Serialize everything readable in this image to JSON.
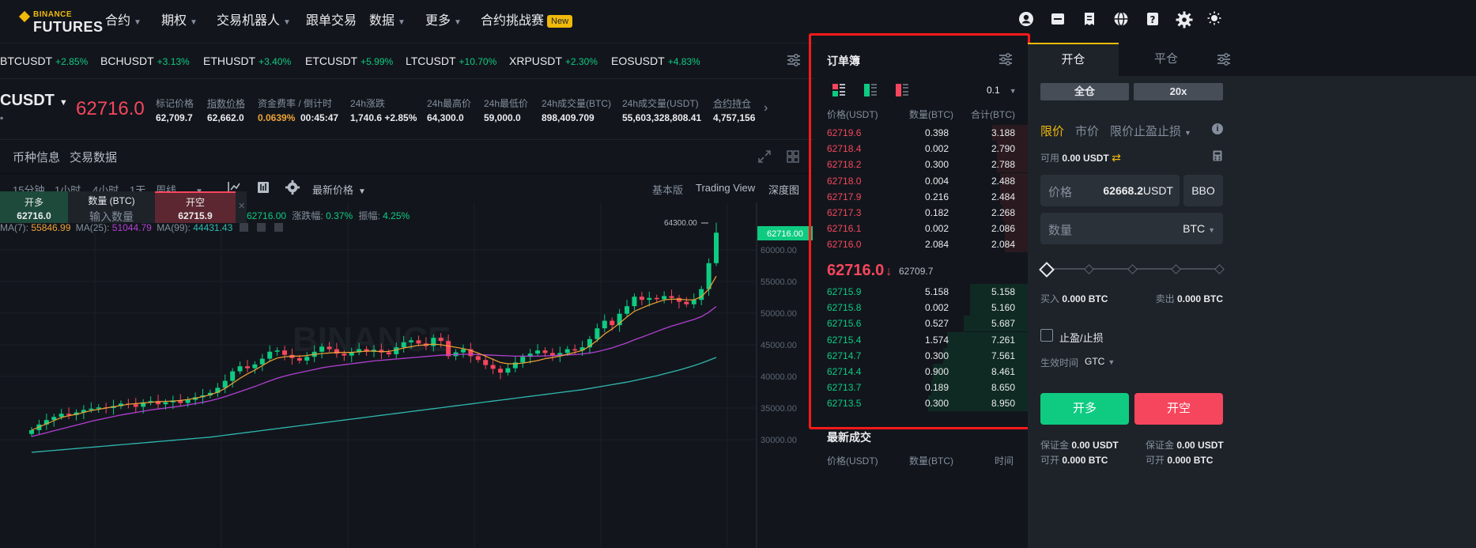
{
  "nav": {
    "logo_top": "BINANCE",
    "logo_bottom": "FUTURES",
    "items": [
      {
        "label": "合约",
        "dropdown": true
      },
      {
        "label": "期权",
        "dropdown": true
      },
      {
        "label": "交易机器人",
        "dropdown": true
      },
      {
        "label": "跟单交易",
        "dropdown": false
      },
      {
        "label": "数据",
        "dropdown": true
      },
      {
        "label": "更多",
        "dropdown": true
      },
      {
        "label": "合约挑战赛",
        "dropdown": false
      }
    ],
    "new_badge": "New",
    "icons": [
      "user-icon",
      "wallet-icon",
      "orders-icon",
      "globe-icon",
      "help-icon",
      "settings-icon",
      "theme-icon"
    ]
  },
  "ticker": [
    {
      "symbol": "BTCUSDT",
      "change": "+2.85%"
    },
    {
      "symbol": "BCHUSDT",
      "change": "+3.13%"
    },
    {
      "symbol": "ETHUSDT",
      "change": "+3.40%"
    },
    {
      "symbol": "ETCUSDT",
      "change": "+5.99%"
    },
    {
      "symbol": "LTCUSDT",
      "change": "+10.70%"
    },
    {
      "symbol": "XRPUSDT",
      "change": "+2.30%"
    },
    {
      "symbol": "EOSUSDT",
      "change": "+4.83%"
    }
  ],
  "stats": {
    "symbol": "CUSDT",
    "last_price": "62716.0",
    "items": [
      {
        "label": "标记价格",
        "value": "62,709.7"
      },
      {
        "label": "指数价格",
        "value": "62,662.0"
      },
      {
        "label": "资金费率 / 倒计时",
        "value": "0.0639%",
        "value2": "00:45:47"
      },
      {
        "label": "24h涨跌",
        "value": "1,740.6 +2.85%"
      },
      {
        "label": "24h最高价",
        "value": "64,300.0"
      },
      {
        "label": "24h最低价",
        "value": "59,000.0"
      },
      {
        "label": "24h成交量(BTC)",
        "value": "898,409.709"
      },
      {
        "label": "24h成交量(USDT)",
        "value": "55,603,328,808.41"
      },
      {
        "label": "合约持仓",
        "value": "4,757,156"
      }
    ]
  },
  "chart_tabs": {
    "tabs": [
      "币种信息",
      "交易数据"
    ],
    "intervals": [
      "15分钟",
      "1小时",
      "4小时",
      "1天",
      "周线"
    ],
    "active_interval": "1天",
    "price_type": "最新价格",
    "views": [
      "基本版",
      "Trading View",
      "深度图"
    ],
    "active_view": "基本版"
  },
  "quick_trade": {
    "long_label": "开多",
    "long_price": "62716.0",
    "qty_label": "数量 (BTC)",
    "qty_placeholder": "输入数量",
    "short_label": "开空",
    "short_price": "62715.9"
  },
  "chart_info": {
    "ohlc_tail": "62716.00",
    "amp_label": "涨跌幅:",
    "amp_value": "0.37%",
    "vib_label": "振幅:",
    "vib_value": "4.25%",
    "ma7_label": "MA(7):",
    "ma7_value": "55846.99",
    "ma25_label": "MA(25):",
    "ma25_value": "51044.79",
    "ma99_label": "MA(99):",
    "ma99_value": "44431.43",
    "high_marker": "64300.00",
    "watermark": "BINANCE"
  },
  "chart_data": {
    "type": "line",
    "title": "",
    "price_tag": "62716.00",
    "y_ticks": [
      "60000.00",
      "55000.00",
      "50000.00",
      "45000.00",
      "40000.00",
      "35000.00",
      "30000.00"
    ],
    "ylim": [
      28000,
      66000
    ],
    "close": [
      31500,
      32400,
      33100,
      33600,
      34100,
      33900,
      34300,
      34700,
      34900,
      35100,
      35000,
      35300,
      35700,
      35600,
      35200,
      35900,
      36100,
      35600,
      35900,
      36200,
      35800,
      36300,
      36700,
      37000,
      37400,
      38200,
      39300,
      40800,
      41600,
      41300,
      41900,
      42800,
      43900,
      44100,
      43400,
      42900,
      42500,
      43100,
      43900,
      44700,
      44300,
      43600,
      43300,
      43800,
      44300,
      43900,
      44200,
      43800,
      43500,
      44600,
      45400,
      45700,
      45200,
      44800,
      46100,
      45600,
      43200,
      43800,
      44300,
      43200,
      42600,
      41800,
      41200,
      40600,
      41300,
      42200,
      43100,
      43600,
      44100,
      43700,
      43300,
      43700,
      44300,
      44100,
      44600,
      45900,
      47600,
      48800,
      48100,
      49900,
      51100,
      52600,
      52100,
      52400,
      52200,
      52700,
      52400,
      51800,
      51400,
      52100,
      53800,
      57900,
      62716
    ],
    "ma7": [
      31500,
      32000,
      32500,
      33000,
      33500,
      33800,
      34000,
      34300,
      34600,
      34800,
      35000,
      35200,
      35400,
      35600,
      35700,
      35800,
      35900,
      36000,
      36050,
      36100,
      36200,
      36350,
      36550,
      36800,
      37100,
      37500,
      38100,
      38900,
      39700,
      40400,
      41000,
      41700,
      42400,
      42900,
      43100,
      43200,
      43200,
      43300,
      43500,
      43600,
      43700,
      43800,
      43800,
      43800,
      43900,
      44000,
      44000,
      43900,
      43950,
      44200,
      44500,
      44700,
      44900,
      45000,
      45100,
      45000,
      44800,
      44600,
      44400,
      44100,
      43700,
      43200,
      42700,
      42200,
      42000,
      42000,
      42100,
      42300,
      42500,
      42800,
      43000,
      43200,
      43500,
      43800,
      44100,
      44800,
      45700,
      46700,
      47500,
      48400,
      49400,
      50300,
      50800,
      51300,
      51700,
      52100,
      52200,
      52200,
      52100,
      52100,
      52600,
      53800,
      55847
    ],
    "ma25": [
      30500,
      30800,
      31100,
      31400,
      31700,
      32000,
      32300,
      32600,
      32900,
      33150,
      33400,
      33650,
      33900,
      34100,
      34300,
      34500,
      34700,
      34850,
      35000,
      35150,
      35300,
      35500,
      35700,
      35900,
      36150,
      36450,
      36800,
      37200,
      37600,
      38000,
      38400,
      38850,
      39300,
      39700,
      40050,
      40350,
      40600,
      40850,
      41100,
      41350,
      41550,
      41700,
      41850,
      42000,
      42150,
      42300,
      42450,
      42550,
      42650,
      42750,
      42850,
      42950,
      43050,
      43150,
      43250,
      43350,
      43400,
      43450,
      43500,
      43500,
      43450,
      43400,
      43350,
      43300,
      43250,
      43200,
      43200,
      43200,
      43200,
      43250,
      43300,
      43350,
      43400,
      43450,
      43550,
      43700,
      43900,
      44200,
      44500,
      44900,
      45300,
      45800,
      46200,
      46650,
      47100,
      47550,
      47950,
      48300,
      48650,
      49000,
      49450,
      50150,
      51045
    ],
    "ma99": [
      28000,
      28100,
      28200,
      28300,
      28400,
      28500,
      28600,
      28700,
      28800,
      28900,
      29000,
      29100,
      29200,
      29300,
      29400,
      29500,
      29600,
      29700,
      29800,
      29900,
      30000,
      30100,
      30200,
      30300,
      30400,
      30550,
      30700,
      30850,
      31000,
      31150,
      31300,
      31450,
      31600,
      31750,
      31900,
      32050,
      32200,
      32350,
      32500,
      32650,
      32800,
      32950,
      33100,
      33250,
      33400,
      33550,
      33700,
      33850,
      34000,
      34150,
      34300,
      34450,
      34600,
      34750,
      34900,
      35050,
      35200,
      35350,
      35500,
      35650,
      35800,
      35950,
      36100,
      36250,
      36400,
      36550,
      36700,
      36850,
      37000,
      37150,
      37300,
      37450,
      37600,
      37750,
      37900,
      38100,
      38300,
      38500,
      38700,
      38900,
      39100,
      39350,
      39600,
      39850,
      40100,
      40400,
      40700,
      41000,
      41350,
      41700,
      42100,
      42550,
      43000
    ],
    "series_colors": {
      "up": "#0ecb81",
      "down": "#f6465d",
      "ma7": "#f0a236",
      "ma25": "#b33fd3",
      "ma99": "#2fb8b0"
    }
  },
  "orderbook": {
    "title": "订单簿",
    "precision": "0.1",
    "headers": [
      "价格(USDT)",
      "数量(BTC)",
      "合计(BTC)"
    ],
    "asks": [
      {
        "price": "62719.6",
        "qty": "0.398",
        "total": "3.188",
        "depth": 0.36
      },
      {
        "price": "62718.4",
        "qty": "0.002",
        "total": "2.790",
        "depth": 0.31
      },
      {
        "price": "62718.2",
        "qty": "0.300",
        "total": "2.788",
        "depth": 0.31
      },
      {
        "price": "62718.0",
        "qty": "0.004",
        "total": "2.488",
        "depth": 0.28
      },
      {
        "price": "62717.9",
        "qty": "0.216",
        "total": "2.484",
        "depth": 0.28
      },
      {
        "price": "62717.3",
        "qty": "0.182",
        "total": "2.268",
        "depth": 0.25
      },
      {
        "price": "62716.1",
        "qty": "0.002",
        "total": "2.086",
        "depth": 0.23
      },
      {
        "price": "62716.0",
        "qty": "2.084",
        "total": "2.084",
        "depth": 0.23
      }
    ],
    "last_price": "62716.0",
    "mark_price": "62709.7",
    "bids": [
      {
        "price": "62715.9",
        "qty": "5.158",
        "total": "5.158",
        "depth": 0.58
      },
      {
        "price": "62715.8",
        "qty": "0.002",
        "total": "5.160",
        "depth": 0.58
      },
      {
        "price": "62715.6",
        "qty": "0.527",
        "total": "5.687",
        "depth": 0.64
      },
      {
        "price": "62715.4",
        "qty": "1.574",
        "total": "7.261",
        "depth": 0.81
      },
      {
        "price": "62714.7",
        "qty": "0.300",
        "total": "7.561",
        "depth": 0.85
      },
      {
        "price": "62714.4",
        "qty": "0.900",
        "total": "8.461",
        "depth": 0.95
      },
      {
        "price": "62713.7",
        "qty": "0.189",
        "total": "8.650",
        "depth": 0.97
      },
      {
        "price": "62713.5",
        "qty": "0.300",
        "total": "8.950",
        "depth": 1.0
      }
    ],
    "recent_trades_title": "最新成交",
    "recent_headers": [
      "价格(USDT)",
      "数量(BTC)",
      "时间"
    ]
  },
  "trade_panel": {
    "tab_open": "开仓",
    "tab_close": "平仓",
    "margin_mode": "全仓",
    "leverage": "20x",
    "order_types": [
      "限价",
      "市价",
      "限价止盈止损"
    ],
    "available_label": "可用",
    "available_value": "0.00 USDT",
    "price_label": "价格",
    "price_value": "62668.2",
    "price_unit": "USDT",
    "bbo": "BBO",
    "qty_label": "数量",
    "qty_unit": "BTC",
    "slider_level": 0,
    "buy_label": "买入",
    "buy_value": "0.000 BTC",
    "sell_label": "卖出",
    "sell_value": "0.000 BTC",
    "tpsl_label": "止盈/止损",
    "tif_label": "生效时间",
    "tif_value": "GTC",
    "long_button": "开多",
    "short_button": "开空",
    "margin_left_label": "保证金",
    "margin_left_value": "0.00 USDT",
    "margin_right_label": "保证金",
    "margin_right_value": "0.00 USDT",
    "maxopen_left_label": "可开",
    "maxopen_left_value": "0.000 BTC",
    "maxopen_right_label": "可开",
    "maxopen_right_value": "0.000 BTC"
  }
}
